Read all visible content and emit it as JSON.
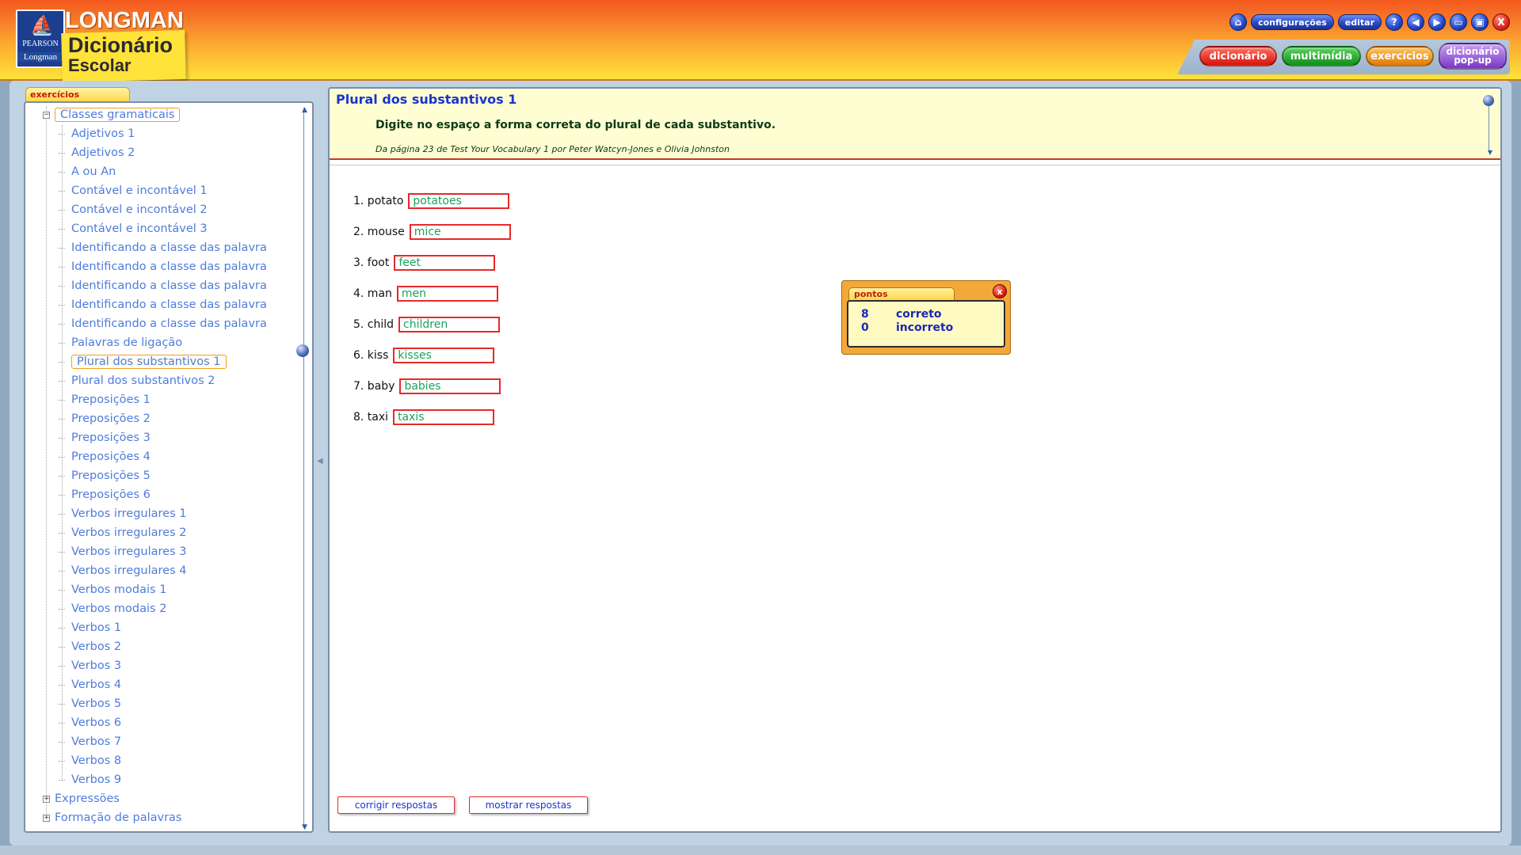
{
  "brand": {
    "title": "LONGMAN",
    "subtitle_line1": "Dicionário",
    "subtitle_line2": "Escolar",
    "logo_line1": "PEARSON",
    "logo_line2": "Longman"
  },
  "toolbar": {
    "home_icon": "home-icon",
    "configuracoes": "configurações",
    "editar": "editar",
    "help": "?",
    "close": "X"
  },
  "nav": {
    "dicionario": "dicionário",
    "multimidia": "multimídia",
    "exercicios": "exercícios",
    "popup_line1": "dicionário",
    "popup_line2": "pop-up"
  },
  "sidebar": {
    "tab_label": "exercícios",
    "root_label": "Classes gramaticais",
    "items": [
      "Adjetivos 1",
      "Adjetivos 2",
      "A ou An",
      "Contável e incontável 1",
      "Contável e incontável 2",
      "Contável e incontável 3",
      "Identificando a classe das palavra",
      "Identificando a classe das palavra",
      "Identificando a classe das palavra",
      "Identificando a classe das palavra",
      "Identificando a classe das palavra",
      "Palavras de ligação",
      "Plural dos substantivos 1",
      "Plural dos substantivos 2",
      "Preposições 1",
      "Preposições 2",
      "Preposições 3",
      "Preposições 4",
      "Preposições 5",
      "Preposições 6",
      "Verbos irregulares 1",
      "Verbos irregulares 2",
      "Verbos irregulares 3",
      "Verbos irregulares 4",
      "Verbos modais 1",
      "Verbos modais 2",
      "Verbos 1",
      "Verbos 2",
      "Verbos 3",
      "Verbos 4",
      "Verbos 5",
      "Verbos 6",
      "Verbos 7",
      "Verbos 8",
      "Verbos 9"
    ],
    "selected_item": "Plural dos substantivos 1",
    "other_roots": [
      "Expressões",
      "Formação de palavras"
    ]
  },
  "exercise": {
    "title": "Plural dos substantivos 1",
    "instruction": "Digite no espaço a forma correta do plural de cada substantivo.",
    "source": "Da página 23 de Test Your Vocabulary 1 por Peter Watcyn-Jones e Olivia Johnston",
    "questions": [
      {
        "label": "1. potato",
        "answer": "potatoes"
      },
      {
        "label": "2. mouse",
        "answer": "mice"
      },
      {
        "label": "3. foot",
        "answer": "feet"
      },
      {
        "label": "4. man",
        "answer": "men"
      },
      {
        "label": "5. child",
        "answer": "children"
      },
      {
        "label": "6. kiss",
        "answer": "kisses"
      },
      {
        "label": "7. baby",
        "answer": "babies"
      },
      {
        "label": "8. taxi",
        "answer": "taxis"
      }
    ],
    "btn_corrigir": "corrigir respostas",
    "btn_mostrar": "mostrar respostas"
  },
  "score": {
    "tab_label": "pontos",
    "close": "x",
    "correct_count": "8",
    "correct_label": "correto",
    "incorrect_count": "0",
    "incorrect_label": "incorreto"
  }
}
